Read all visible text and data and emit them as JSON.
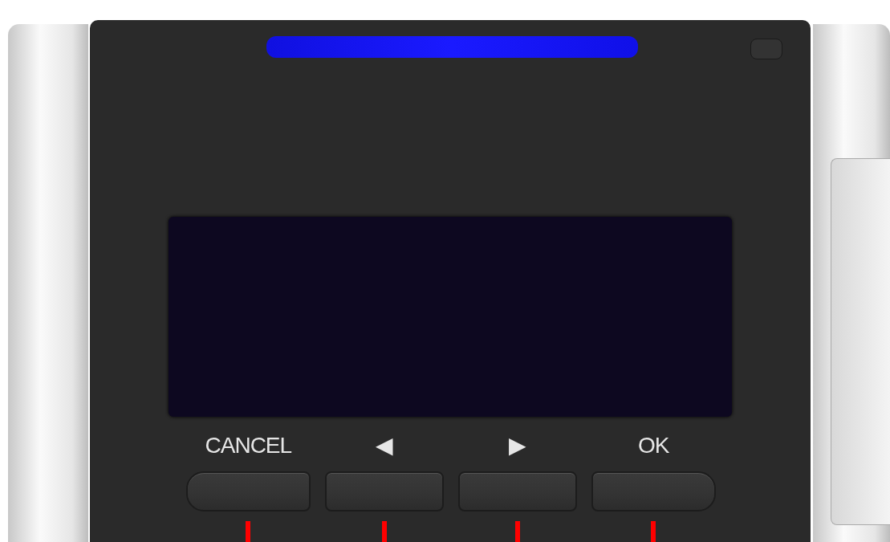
{
  "indicator": {
    "on": true
  },
  "keys": [
    {
      "label": "CANCEL"
    },
    {
      "label": "◀"
    },
    {
      "label": "▶"
    },
    {
      "label": "OK"
    }
  ]
}
